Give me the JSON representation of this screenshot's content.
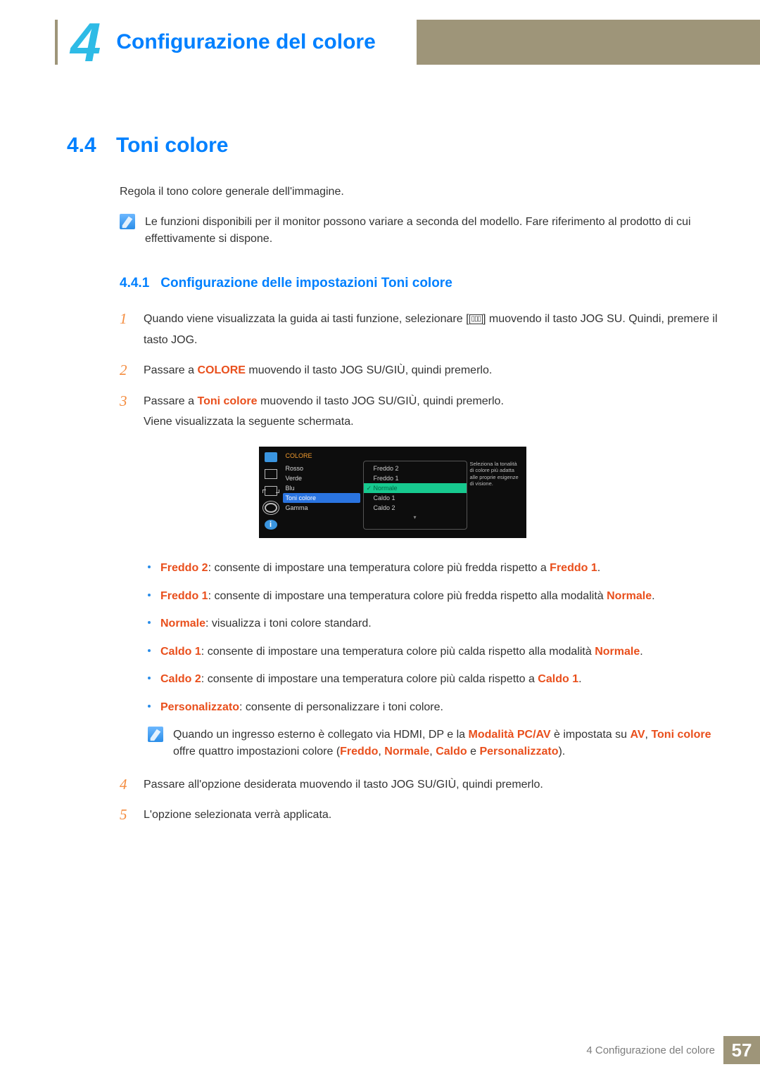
{
  "chapter": {
    "number": "4",
    "title": "Configurazione del colore"
  },
  "section": {
    "number": "4.4",
    "title": "Toni colore"
  },
  "intro": "Regola il tono colore generale dell'immagine.",
  "note_top": "Le funzioni disponibili per il monitor possono variare a seconda del modello. Fare riferimento al prodotto di cui effettivamente si dispone.",
  "subsection": {
    "number": "4.4.1",
    "title": "Configurazione delle impostazioni Toni colore"
  },
  "steps": {
    "s1a": "Quando viene visualizzata la guida ai tasti funzione, selezionare [",
    "s1b": "] muovendo il tasto JOG SU. Quindi, premere il tasto JOG.",
    "s2a": "Passare a ",
    "s2_hl": "COLORE",
    "s2b": " muovendo il tasto JOG SU/GIÙ, quindi premerlo.",
    "s3a": "Passare a ",
    "s3_hl": "Toni colore",
    "s3b": " muovendo il tasto JOG SU/GIÙ, quindi premerlo.",
    "s3c": "Viene visualizzata la seguente schermata.",
    "s4": "Passare all'opzione desiderata muovendo il tasto JOG SU/GIÙ, quindi premerlo.",
    "s5": "L'opzione selezionata verrà applicata."
  },
  "step_numbers": {
    "n1": "1",
    "n2": "2",
    "n3": "3",
    "n4": "4",
    "n5": "5"
  },
  "osd": {
    "title": "COLORE",
    "menu": [
      "Rosso",
      "Verde",
      "Blu",
      "Toni colore",
      "Gamma"
    ],
    "menu_active_index": 3,
    "options": [
      "Freddo 2",
      "Freddo 1",
      "Normale",
      "Caldo 1",
      "Caldo 2"
    ],
    "options_selected_index": 2,
    "help": "Seleziona la tonalità di colore più adatta alle proprie esigenze di visione.",
    "info_glyph": "i"
  },
  "bullets": {
    "b1_hl": "Freddo 2",
    "b1": ": consente di impostare una temperatura colore più fredda rispetto a ",
    "b1_hl2": "Freddo 1",
    "b1_end": ".",
    "b2_hl": "Freddo 1",
    "b2": ": consente di impostare una temperatura colore più fredda rispetto alla modalità ",
    "b2_hl2": "Normale",
    "b2_end": ".",
    "b3_hl": "Normale",
    "b3": ": visualizza i toni colore standard.",
    "b4_hl": "Caldo 1",
    "b4": ": consente di impostare una temperatura colore più calda rispetto alla modalità ",
    "b4_hl2": "Normale",
    "b4_end": ".",
    "b5_hl": "Caldo 2",
    "b5": ": consente di impostare una temperatura colore più calda rispetto a ",
    "b5_hl2": "Caldo 1",
    "b5_end": ".",
    "b6_hl": "Personalizzato",
    "b6": ": consente di personalizzare i toni colore."
  },
  "note_bottom": {
    "t1": "Quando un ingresso esterno è collegato via HDMI, DP e la ",
    "hl1": "Modalità PC/AV",
    "t2": " è impostata su ",
    "hl2": "AV",
    "t3": ", ",
    "hl3": "Toni colore",
    "t4": " offre quattro impostazioni colore (",
    "hl4": "Freddo",
    "t5": ", ",
    "hl5": "Normale",
    "t6": ", ",
    "hl6": "Caldo",
    "t7": " e ",
    "hl7": "Personalizzato",
    "t8": ")."
  },
  "footer": {
    "text": "4 Configurazione del colore",
    "page": "57"
  },
  "glyph": {
    "menu": "▥"
  }
}
